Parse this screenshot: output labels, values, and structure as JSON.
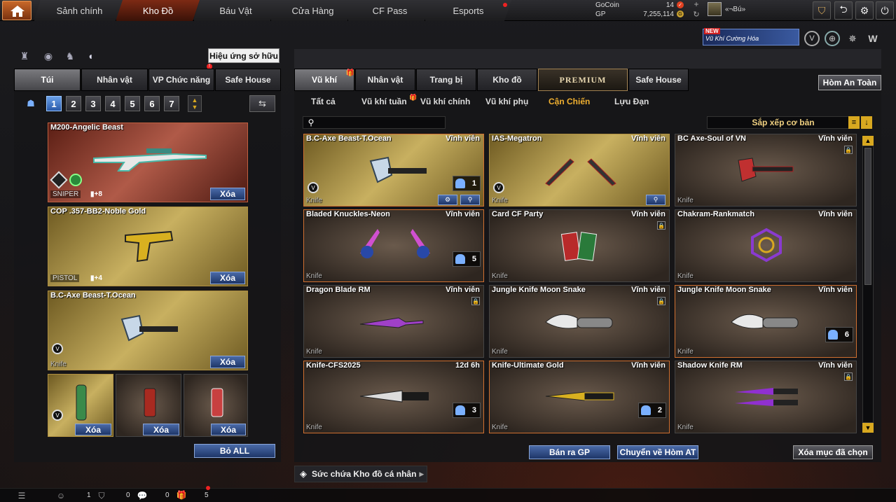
{
  "nav": {
    "items": [
      "Sảnh chính",
      "Kho Đồ",
      "Báu Vật",
      "Cửa Hàng",
      "CF Pass",
      "Esports"
    ]
  },
  "currency": {
    "gocoin_label": "GoCoin",
    "gocoin_value": "14",
    "gp_label": "GP",
    "gp_value": "7,255,114",
    "player_name": "«¬Bú»"
  },
  "promo": {
    "new_label": "NEW",
    "text": "Vũ Khí Cường Hóa"
  },
  "left": {
    "effect_button": "Hiệu ứng sở hữu",
    "tabs": [
      "Túi",
      "Nhân vật",
      "VP Chức năng",
      "Safe House"
    ],
    "slots": [
      "1",
      "2",
      "3",
      "4",
      "5",
      "6",
      "7"
    ],
    "cards": [
      {
        "name": "M200-Angelic Beast",
        "type": "SNIPER",
        "bonus": "+8",
        "remove": "Xóa"
      },
      {
        "name": "COP .357-BB2-Noble Gold",
        "type": "PISTOL",
        "bonus": "+4",
        "remove": "Xóa"
      },
      {
        "name": "B.C-Axe Beast-T.Ocean",
        "type": "Knife",
        "remove": "Xóa"
      }
    ],
    "small_cards": [
      {
        "remove": "Xóa"
      },
      {
        "remove": "Xóa"
      },
      {
        "remove": "Xóa"
      }
    ],
    "remove_all": "Bỏ ALL"
  },
  "right": {
    "tabs": [
      "Vũ khí",
      "Nhân vật",
      "Trang bị",
      "Kho đồ",
      "PREMIUM",
      "Safe House"
    ],
    "safe_button": "Hòm An Toàn",
    "subtabs": [
      "Tất cả",
      "Vũ khí tuần",
      "Vũ khí chính",
      "Vũ khí phụ",
      "Cận Chiến",
      "Lựu Đạn"
    ],
    "search_placeholder": "",
    "sort_label": "Sắp xếp cơ bản",
    "items": [
      {
        "name": "B.C-Axe Beast-T.Ocean",
        "duration": "Vĩnh viễn",
        "type": "Knife",
        "count": "1"
      },
      {
        "name": "IAS-Megatron",
        "duration": "Vĩnh viễn",
        "type": "Knife"
      },
      {
        "name": "BC Axe-Soul of VN",
        "duration": "Vĩnh viễn",
        "type": "Knife"
      },
      {
        "name": "Bladed Knuckles-Neon",
        "duration": "Vĩnh viễn",
        "type": "Knife",
        "count": "5"
      },
      {
        "name": "Card CF Party",
        "duration": "Vĩnh viễn",
        "type": "Knife"
      },
      {
        "name": "Chakram-Rankmatch",
        "duration": "Vĩnh viễn",
        "type": "Knife"
      },
      {
        "name": "Dragon Blade RM",
        "duration": "Vĩnh viễn",
        "type": "Knife"
      },
      {
        "name": "Jungle Knife Moon Snake",
        "duration": "Vĩnh viễn",
        "type": "Knife"
      },
      {
        "name": "Jungle Knife Moon Snake",
        "duration": "Vĩnh viễn",
        "type": "Knife",
        "count": "6"
      },
      {
        "name": "Knife-CFS2025",
        "duration": "12d 6h",
        "type": "Knife",
        "count": "3"
      },
      {
        "name": "Knife-Ultimate Gold",
        "duration": "Vĩnh viễn",
        "type": "Knife",
        "count": "2"
      },
      {
        "name": "Shadow Knife RM",
        "duration": "Vĩnh viễn",
        "type": "Knife"
      }
    ],
    "sell_button": "Bán ra GP",
    "move_button": "Chuyển về Hòm AT",
    "delete_button": "Xóa mục đã chọn",
    "capacity_label": "Sức chứa Kho đồ cá nhân"
  },
  "statusbar": {
    "friends": "1",
    "shield": "0",
    "chat": "0",
    "gift": "5"
  },
  "colors": {
    "accent": "#f0b030",
    "button_blue": "#1e3668",
    "active_nav": "#7d2a14"
  }
}
